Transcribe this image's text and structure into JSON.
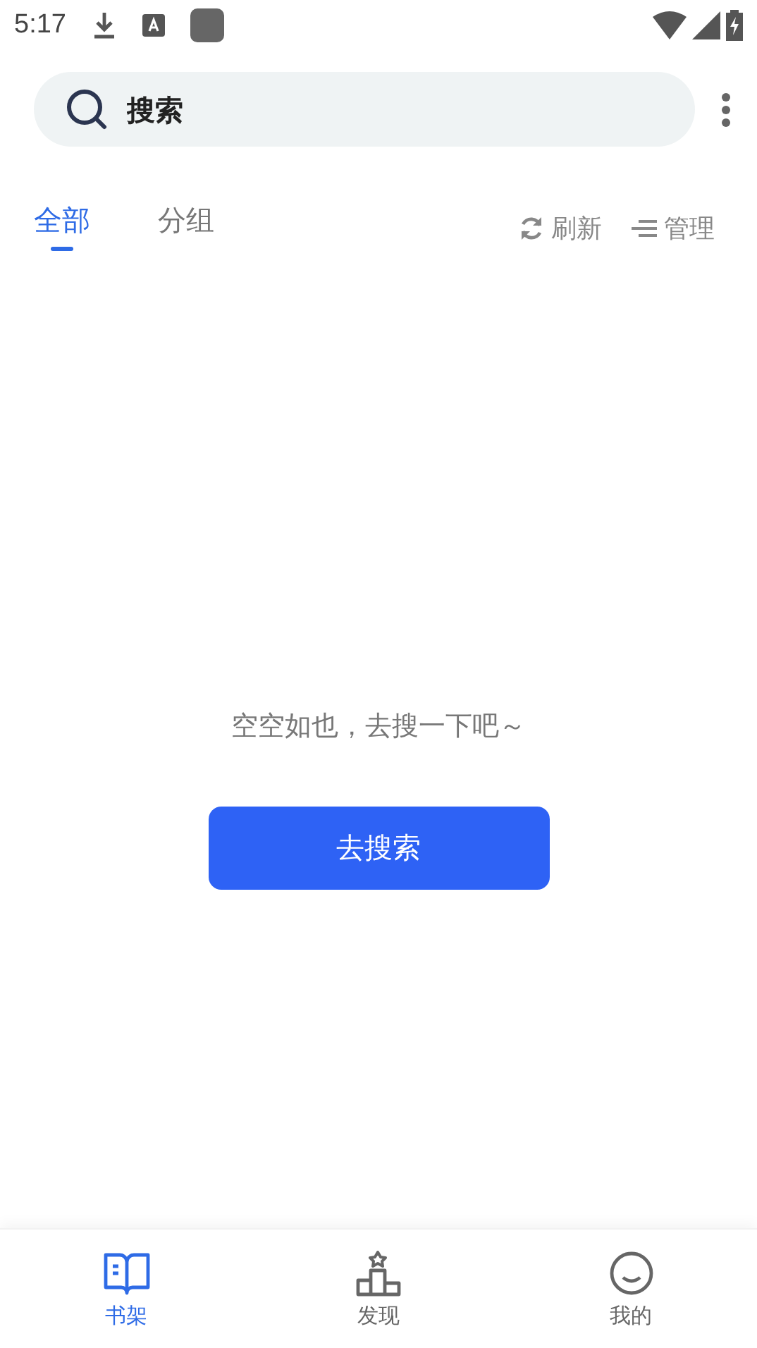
{
  "status_bar": {
    "time": "5:17"
  },
  "search": {
    "placeholder": "搜索"
  },
  "tabs": [
    {
      "label": "全部",
      "selected": true
    },
    {
      "label": "分组",
      "selected": false
    }
  ],
  "actions": [
    {
      "kind": "refresh",
      "label": "刷新"
    },
    {
      "kind": "manage",
      "label": "管理"
    }
  ],
  "empty": {
    "message": "空空如也，去搜一下吧～",
    "button": "去搜索"
  },
  "bottom_nav": [
    {
      "kind": "shelf",
      "label": "书架",
      "selected": true
    },
    {
      "kind": "discover",
      "label": "发现",
      "selected": false
    },
    {
      "kind": "profile",
      "label": "我的",
      "selected": false
    }
  ]
}
